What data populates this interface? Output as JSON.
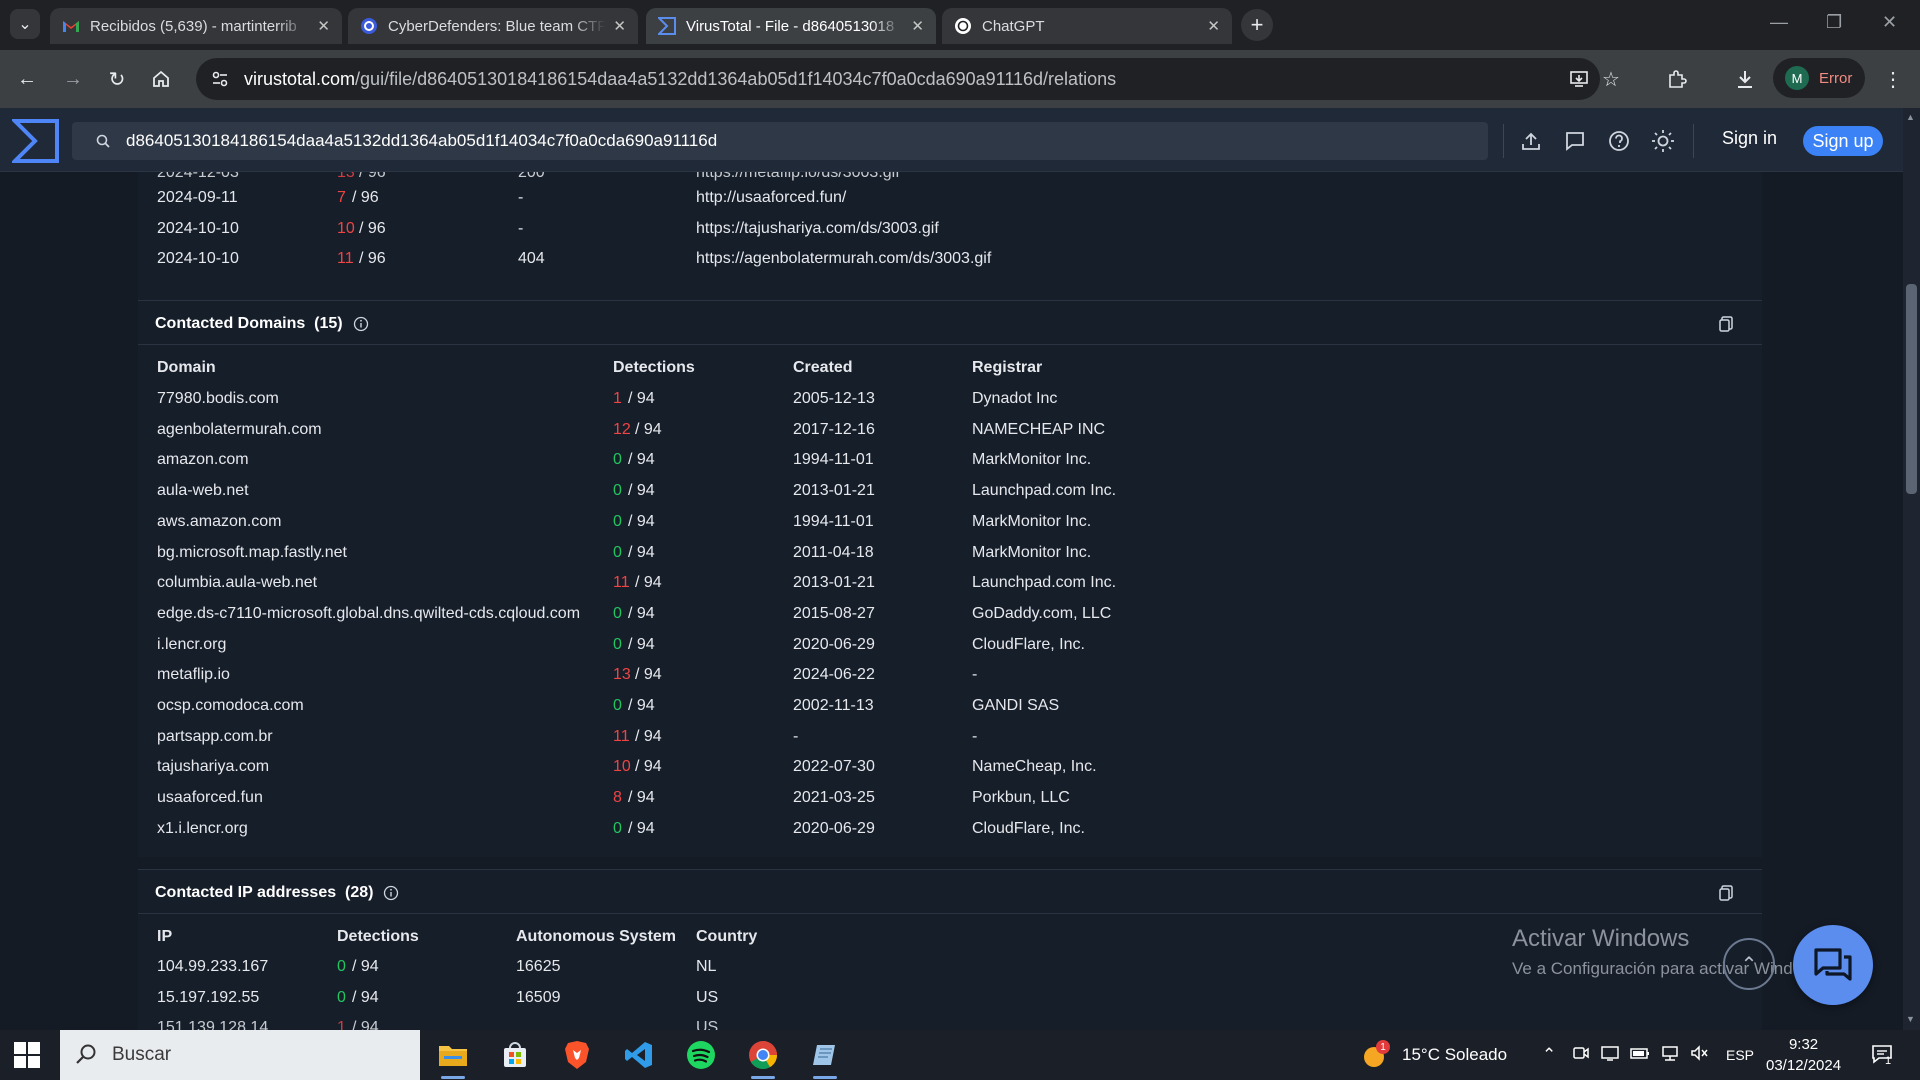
{
  "browser": {
    "tabs": [
      {
        "title": "Recibidos (5,639) - martinterrib",
        "icon": "gmail-icon"
      },
      {
        "title": "CyberDefenders: Blue team CTF",
        "icon": "cyberdefenders-icon"
      },
      {
        "title": "VirusTotal - File - d8640513018",
        "icon": "virustotal-icon"
      },
      {
        "title": "ChatGPT",
        "icon": "chatgpt-icon"
      }
    ],
    "url_host": "virustotal.com",
    "url_path": "/gui/file/d86405130184186154daa4a5132dd1364ab05d1f14034c7f0a0cda690a91116d/relations",
    "profile_initial": "M",
    "profile_status": "Error"
  },
  "vt": {
    "search_value": "d86405130184186154daa4a5132dd1364ab05d1f14034c7f0a0cda690a91116d",
    "sign_in": "Sign in",
    "sign_up": "Sign up"
  },
  "urls_partial": {
    "rows": [
      {
        "date": "2024-09-11",
        "det": "7",
        "total": " / 96",
        "status": "-",
        "url": "http://usaaforced.fun/"
      },
      {
        "date": "2024-10-10",
        "det": "10",
        "total": " / 96",
        "status": "-",
        "url": "https://tajushariya.com/ds/3003.gif"
      },
      {
        "date": "2024-10-10",
        "det": "11",
        "total": " / 96",
        "status": "404",
        "url": "https://agenbolatermurah.com/ds/3003.gif"
      }
    ]
  },
  "domains": {
    "title": "Contacted Domains",
    "count": "(15)",
    "headers": {
      "domain": "Domain",
      "detections": "Detections",
      "created": "Created",
      "registrar": "Registrar"
    },
    "rows": [
      {
        "domain": "77980.bodis.com",
        "det": "1",
        "total": " / 94",
        "created": "2005-12-13",
        "registrar": "Dynadot Inc"
      },
      {
        "domain": "agenbolatermurah.com",
        "det": "12",
        "total": " / 94",
        "created": "2017-12-16",
        "registrar": "NAMECHEAP INC"
      },
      {
        "domain": "amazon.com",
        "det": "0",
        "total": " / 94",
        "created": "1994-11-01",
        "registrar": "MarkMonitor Inc."
      },
      {
        "domain": "aula-web.net",
        "det": "0",
        "total": " / 94",
        "created": "2013-01-21",
        "registrar": "Launchpad.com Inc."
      },
      {
        "domain": "aws.amazon.com",
        "det": "0",
        "total": " / 94",
        "created": "1994-11-01",
        "registrar": "MarkMonitor Inc."
      },
      {
        "domain": "bg.microsoft.map.fastly.net",
        "det": "0",
        "total": " / 94",
        "created": "2011-04-18",
        "registrar": "MarkMonitor Inc."
      },
      {
        "domain": "columbia.aula-web.net",
        "det": "11",
        "total": " / 94",
        "created": "2013-01-21",
        "registrar": "Launchpad.com Inc."
      },
      {
        "domain": "edge.ds-c7110-microsoft.global.dns.qwilted-cds.cqloud.com",
        "det": "0",
        "total": " / 94",
        "created": "2015-08-27",
        "registrar": "GoDaddy.com, LLC"
      },
      {
        "domain": "i.lencr.org",
        "det": "0",
        "total": " / 94",
        "created": "2020-06-29",
        "registrar": "CloudFlare, Inc."
      },
      {
        "domain": "metaflip.io",
        "det": "13",
        "total": " / 94",
        "created": "2024-06-22",
        "registrar": "-"
      },
      {
        "domain": "ocsp.comodoca.com",
        "det": "0",
        "total": " / 94",
        "created": "2002-11-13",
        "registrar": "GANDI SAS"
      },
      {
        "domain": "partsapp.com.br",
        "det": "11",
        "total": " / 94",
        "created": "-",
        "registrar": "-"
      },
      {
        "domain": "tajushariya.com",
        "det": "10",
        "total": " / 94",
        "created": "2022-07-30",
        "registrar": "NameCheap, Inc."
      },
      {
        "domain": "usaaforced.fun",
        "det": "8",
        "total": " / 94",
        "created": "2021-03-25",
        "registrar": "Porkbun, LLC"
      },
      {
        "domain": "x1.i.lencr.org",
        "det": "0",
        "total": " / 94",
        "created": "2020-06-29",
        "registrar": "CloudFlare, Inc."
      }
    ]
  },
  "ips": {
    "title": "Contacted IP addresses",
    "count": "(28)",
    "headers": {
      "ip": "IP",
      "detections": "Detections",
      "as": "Autonomous System",
      "country": "Country"
    },
    "rows": [
      {
        "ip": "104.99.233.167",
        "det": "0",
        "total": " / 94",
        "as": "16625",
        "country": "NL"
      },
      {
        "ip": "15.197.192.55",
        "det": "0",
        "total": " / 94",
        "as": "16509",
        "country": "US"
      }
    ]
  },
  "watermark": {
    "line1": "Activar Windows",
    "line2": "Ve a Configuración para activar Windows."
  },
  "taskbar": {
    "search_placeholder": "Buscar",
    "weather": "15°C  Soleado",
    "weather_badge": "1",
    "lang": "ESP",
    "time": "9:32",
    "date": "03/12/2024",
    "notif_count": "1"
  },
  "colors": {
    "detection_positive": "#ef4444",
    "detection_zero": "#22c55e",
    "accent": "#3b82f6"
  }
}
